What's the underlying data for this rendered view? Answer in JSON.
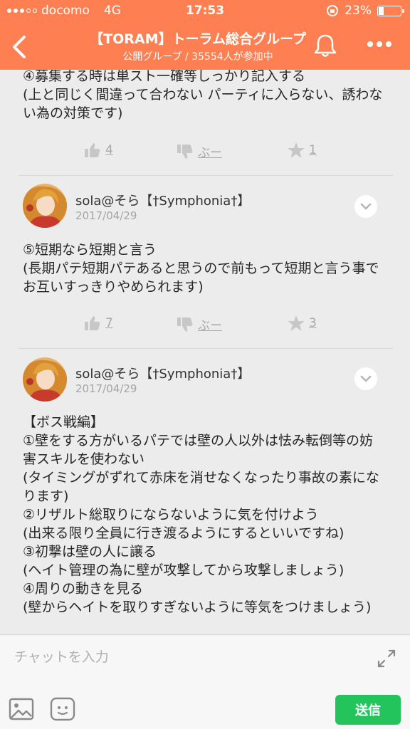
{
  "status_bar": {
    "carrier": "docomo",
    "network": "4G",
    "time": "17:53",
    "battery": "23%"
  },
  "header": {
    "title": "【TORAM】トーラム総合グループ",
    "subtitle": "公開グループ / 35554人が参加中",
    "color": "#fe8052"
  },
  "posts": [
    {
      "text": "④募集する時は単スト一確等しっかり記入する\n(上と同じく間違って合わない パーティに入らない、誘わない為の対策です)",
      "likes": "4",
      "dislike_label": "ぶー",
      "favorites": "1"
    },
    {
      "author": "sola@そら【†Symphonia†】",
      "date": "2017/04/29",
      "text": "⑤短期なら短期と言う\n(長期パテ短期パテあると思うので前もって短期と言う事でお互いすっきりやめられます)",
      "likes": "7",
      "dislike_label": "ぶー",
      "favorites": "3"
    },
    {
      "author": "sola@そら【†Symphonia†】",
      "date": "2017/04/29",
      "text": "【ボス戦編】\n①壁をする方がいるパテでは壁の人以外は怯み転倒等の妨害スキルを使わない\n(タイミングがずれて赤床を消せなくなったり事故の素になります)\n②リザルト総取りにならないように気を付けよう\n(出来る限り全員に行き渡るようにするといいですね)\n③初撃は壁の人に譲る\n(ヘイト管理の為に壁が攻撃してから攻撃しましょう)\n④周りの動きを見る\n(壁からヘイトを取りすぎないように等気をつけましょう)"
    }
  ],
  "composer": {
    "placeholder": "チャットを入力",
    "send_label": "送信",
    "send_color": "#22c45b"
  }
}
